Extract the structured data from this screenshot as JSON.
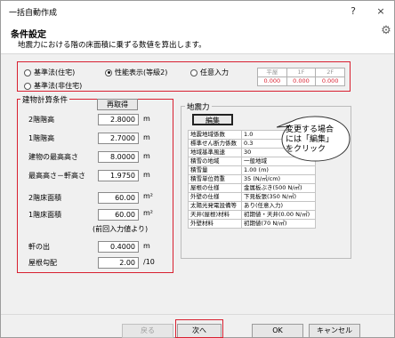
{
  "window": {
    "title": "一括自動作成",
    "help": "?",
    "close": "×"
  },
  "header": {
    "title": "条件設定",
    "subtitle": "地震力における階の床面積に乗ずる数値を算出します。"
  },
  "radios": {
    "std_house": "基準法(住宅)",
    "performance": "性能表示(等級2)",
    "arbitrary": "任意入力",
    "std_nonhouse": "基準法(非住宅)",
    "selected": "performance"
  },
  "floor_table": {
    "headers": [
      "平屋",
      "1F",
      "2F"
    ],
    "values": [
      "0.000",
      "0.000",
      "0.000"
    ]
  },
  "calc": {
    "group_label": "建物計算条件",
    "reacquire": "再取得",
    "rows": [
      {
        "label": "2階階高",
        "value": "2.8000",
        "unit": "m"
      },
      {
        "label": "1階階高",
        "value": "2.7000",
        "unit": "m"
      },
      {
        "label": "建物の最高高さ",
        "value": "8.0000",
        "unit": "m"
      },
      {
        "label": "最高高さ－軒高さ",
        "value": "1.9750",
        "unit": "m"
      },
      {
        "label": "2階床面積",
        "value": "60.00",
        "unit": "m²"
      },
      {
        "label": "1階床面積",
        "value": "60.00",
        "unit": "m²"
      },
      {
        "label": "軒の出",
        "value": "0.4000",
        "unit": "m"
      },
      {
        "label": "屋根勾配",
        "value": "2.00",
        "unit": "/10"
      }
    ],
    "note": "(前回入力値より)"
  },
  "seismic": {
    "group_label": "地震力",
    "edit": "編集",
    "params": [
      [
        "地震地域係数",
        "1.0"
      ],
      [
        "標準せん断力係数",
        "0.3"
      ],
      [
        "地域基準風速",
        "30"
      ],
      [
        "積雪の地域",
        "一般地域"
      ],
      [
        "積雪量",
        "1.00 (m)"
      ],
      [
        "積雪単位荷重",
        "35 (N/㎡/cm)"
      ],
      [
        "屋根の仕様",
        "金属板ぶき(500 N/㎡)"
      ],
      [
        "外壁の仕様",
        "下見板張(350 N/㎡)"
      ],
      [
        "太陽光発電設備等",
        "あり(任意入力)"
      ],
      [
        "天井(屋根)材料",
        "初期値・天井(0.00 N/㎡)"
      ],
      [
        "外壁材料",
        "初期値(70 N/㎡)"
      ]
    ]
  },
  "callout": {
    "line1": "変更する場合",
    "line2": "には「編集」",
    "line3": "をクリック"
  },
  "footer": {
    "back": "戻る",
    "next": "次へ",
    "ok": "OK",
    "cancel": "キャンセル"
  },
  "colors": {
    "highlight": "#d82030"
  }
}
